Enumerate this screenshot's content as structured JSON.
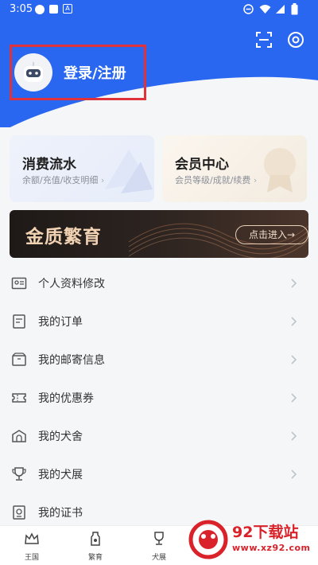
{
  "status": {
    "time": "3:05",
    "app_badge": "A"
  },
  "header": {
    "login_label": "登录/注册"
  },
  "cards": [
    {
      "title": "消费流水",
      "subtitle": "余额/充值/收支明细"
    },
    {
      "title": "会员中心",
      "subtitle": "会员等级/成就/续费"
    }
  ],
  "banner": {
    "title": "金质繁育",
    "button_label": "点击进入→"
  },
  "menu": [
    {
      "label": "个人资料修改",
      "icon": "id-card-icon"
    },
    {
      "label": "我的订单",
      "icon": "order-icon"
    },
    {
      "label": "我的邮寄信息",
      "icon": "package-icon"
    },
    {
      "label": "我的优惠券",
      "icon": "coupon-icon"
    },
    {
      "label": "我的犬舍",
      "icon": "kennel-icon"
    },
    {
      "label": "我的犬展",
      "icon": "trophy-icon"
    },
    {
      "label": "我的证书",
      "icon": "certificate-icon"
    }
  ],
  "tabbar": [
    {
      "label": "王国",
      "icon": "crown-icon"
    },
    {
      "label": "繁育",
      "icon": "bottle-icon"
    },
    {
      "label": "犬展",
      "icon": "trophy-icon"
    }
  ],
  "watermark": {
    "title": "92下载站",
    "url": "www.xz92.com"
  },
  "colors": {
    "header_blue": "#2a67f0",
    "highlight_red": "#e0323a",
    "banner_gold": "#f1d3b4",
    "watermark_red": "#d9222a"
  }
}
